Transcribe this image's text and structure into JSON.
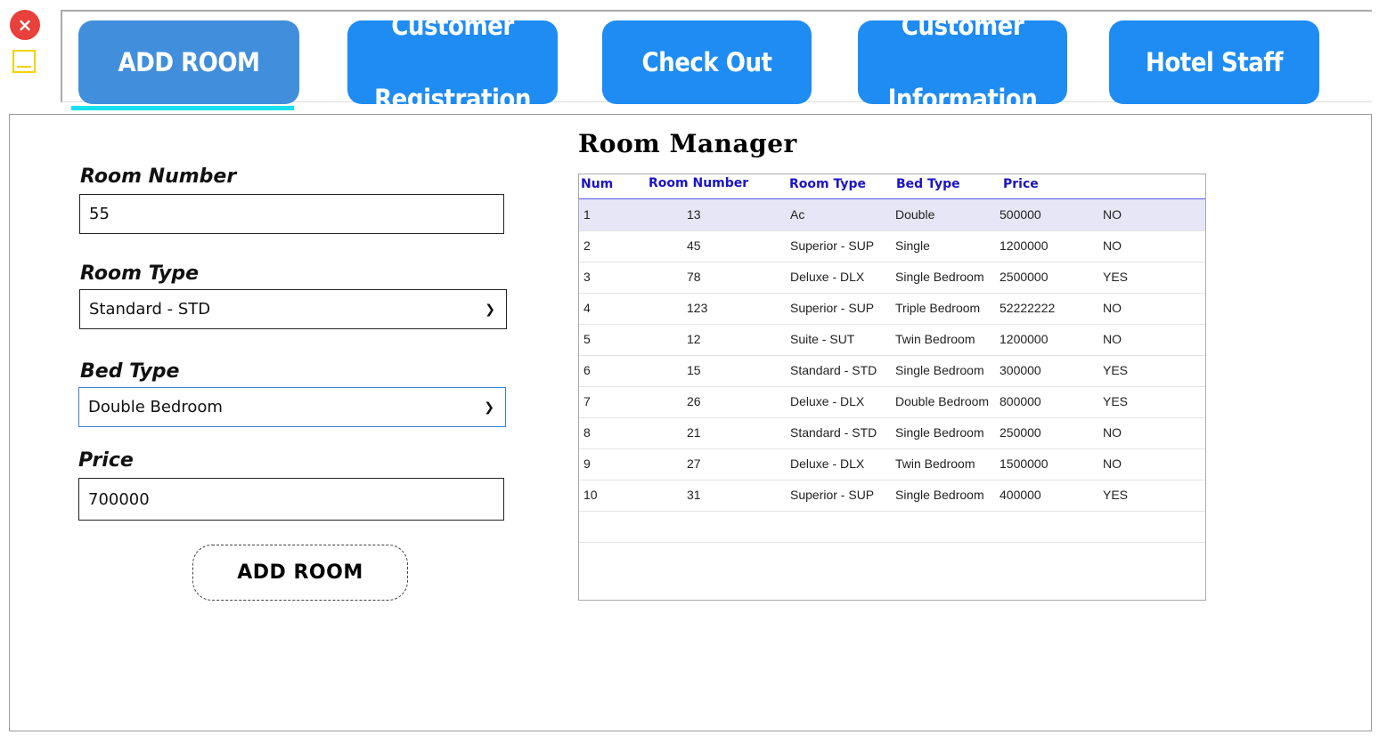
{
  "window": {
    "close_glyph": "×"
  },
  "nav": {
    "tabs": [
      {
        "label": "ADD ROOM",
        "active": true
      },
      {
        "label": "Customer Registration",
        "active": false
      },
      {
        "label": "Check Out",
        "active": false
      },
      {
        "label": "Customer Information",
        "active": false
      },
      {
        "label": "Hotel Staff",
        "active": false
      }
    ]
  },
  "form": {
    "room_number": {
      "label": "Room Number",
      "value": "55"
    },
    "room_type": {
      "label": "Room Type",
      "value": "Standard - STD"
    },
    "bed_type": {
      "label": "Bed Type",
      "value": "Double Bedroom"
    },
    "price": {
      "label": "Price",
      "value": "700000"
    },
    "submit_label": "ADD ROOM"
  },
  "grid": {
    "title": "Room Manager",
    "columns": [
      "Num",
      "Room Number",
      "Room Type",
      "Bed Type",
      "Price",
      ""
    ],
    "rows": [
      [
        "1",
        "13",
        "Ac",
        "Double",
        "500000",
        "NO"
      ],
      [
        "2",
        "45",
        "Superior - SUP",
        "Single",
        "1200000",
        "NO"
      ],
      [
        "3",
        "78",
        "Deluxe - DLX",
        "Single Bedroom",
        "2500000",
        "YES"
      ],
      [
        "4",
        "123",
        "Superior - SUP",
        "Triple Bedroom",
        "52222222",
        "NO"
      ],
      [
        "5",
        "12",
        "Suite - SUT",
        "Twin Bedroom",
        "1200000",
        "NO"
      ],
      [
        "6",
        "15",
        "Standard - STD",
        "Single Bedroom",
        "300000",
        "YES"
      ],
      [
        "7",
        "26",
        "Deluxe - DLX",
        "Double Bedroom",
        "800000",
        "YES"
      ],
      [
        "8",
        "21",
        "Standard - STD",
        "Single Bedroom",
        "250000",
        "NO"
      ],
      [
        "9",
        "27",
        "Deluxe - DLX",
        "Twin Bedroom",
        "1500000",
        "NO"
      ],
      [
        "10",
        "31",
        "Superior - SUP",
        "Single Bedroom",
        "400000",
        "YES"
      ]
    ]
  },
  "colors": {
    "tab_blue": "#1e8cf3",
    "tab_active": "#418fdc",
    "underline": "#14e0f0",
    "header_text": "#1b14c8",
    "header_rule": "#5a5ae8",
    "close_red": "#e8413b",
    "minimize_yellow": "#f3d300"
  }
}
